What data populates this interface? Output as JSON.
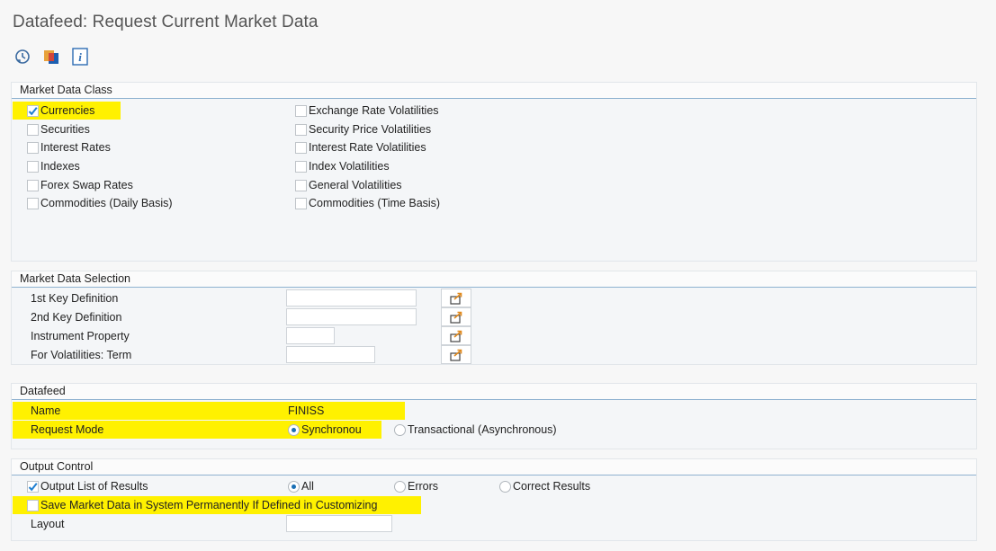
{
  "window": {
    "title": "Datafeed: Request Current Market Data"
  },
  "toolbar": {
    "execute_icon": "execute-clock-icon",
    "variant_icon": "get-variant-icon",
    "info_icon": "info-icon"
  },
  "market_data_class": {
    "header": "Market Data Class",
    "left": [
      {
        "label": "Currencies",
        "checked": true
      },
      {
        "label": "Securities",
        "checked": false
      },
      {
        "label": "Interest Rates",
        "checked": false
      },
      {
        "label": "Indexes",
        "checked": false
      },
      {
        "label": "Forex Swap Rates",
        "checked": false
      },
      {
        "label": "Commodities (Daily Basis)",
        "checked": false
      }
    ],
    "right": [
      {
        "label": "Exchange Rate Volatilities",
        "checked": false
      },
      {
        "label": "Security Price Volatilities",
        "checked": false
      },
      {
        "label": "Interest Rate Volatilities",
        "checked": false
      },
      {
        "label": "Index Volatilities",
        "checked": false
      },
      {
        "label": "General Volatilities",
        "checked": false
      },
      {
        "label": "Commodities (Time Basis)",
        "checked": false
      }
    ]
  },
  "market_data_selection": {
    "header": "Market Data Selection",
    "fields": [
      {
        "label": "1st Key Definition",
        "value": ""
      },
      {
        "label": "2nd Key Definition",
        "value": ""
      },
      {
        "label": "Instrument Property",
        "value": ""
      },
      {
        "label": "For Volatilities: Term",
        "value": ""
      }
    ]
  },
  "datafeed": {
    "header": "Datafeed",
    "name_label": "Name",
    "name_value": "FINISS",
    "mode_label": "Request Mode",
    "mode_options": [
      "Synchronou",
      "Transactional (Asynchronous)"
    ],
    "mode_selected": "Synchronou"
  },
  "output_control": {
    "header": "Output Control",
    "output_list_label": "Output List of Results",
    "output_list_checked": true,
    "result_options": [
      "All",
      "Errors",
      "Correct Results"
    ],
    "result_selected": "All",
    "save_label": "Save Market Data in System Permanently If Defined in Customizing",
    "save_checked": false,
    "layout_label": "Layout",
    "layout_value": ""
  },
  "colors": {
    "highlight": "#fff100",
    "accent_blue": "#1a6fb5",
    "check_green": "#1f7fd1"
  }
}
